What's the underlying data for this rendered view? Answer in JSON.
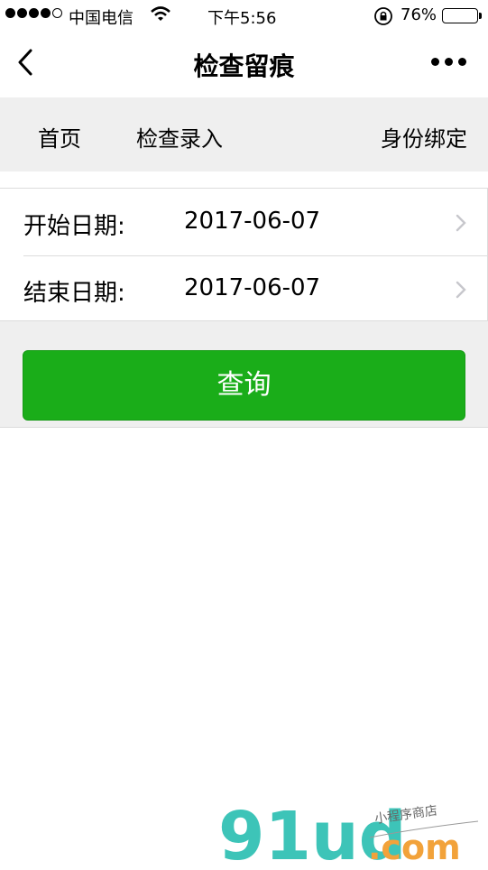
{
  "status_bar": {
    "carrier": "中国电信",
    "time": "下午5:56",
    "battery_percent": "76%",
    "battery_level": 0.76
  },
  "nav": {
    "title": "检查留痕"
  },
  "tabs": [
    {
      "label": "首页"
    },
    {
      "label": "检查录入"
    },
    {
      "label": "身份绑定"
    }
  ],
  "form": {
    "start": {
      "label": "开始日期:",
      "value": "2017-06-07"
    },
    "end": {
      "label": "结束日期:",
      "value": "2017-06-07"
    }
  },
  "query_button": {
    "label": "查询"
  },
  "watermark": {
    "brand": "91ud",
    "suffix": ".com",
    "tagline": "小程序商店"
  },
  "colors": {
    "primary_green": "#1aad19",
    "tab_bg": "#efefef",
    "watermark_teal": "#3dc4b8",
    "watermark_orange": "#f2a23a"
  }
}
